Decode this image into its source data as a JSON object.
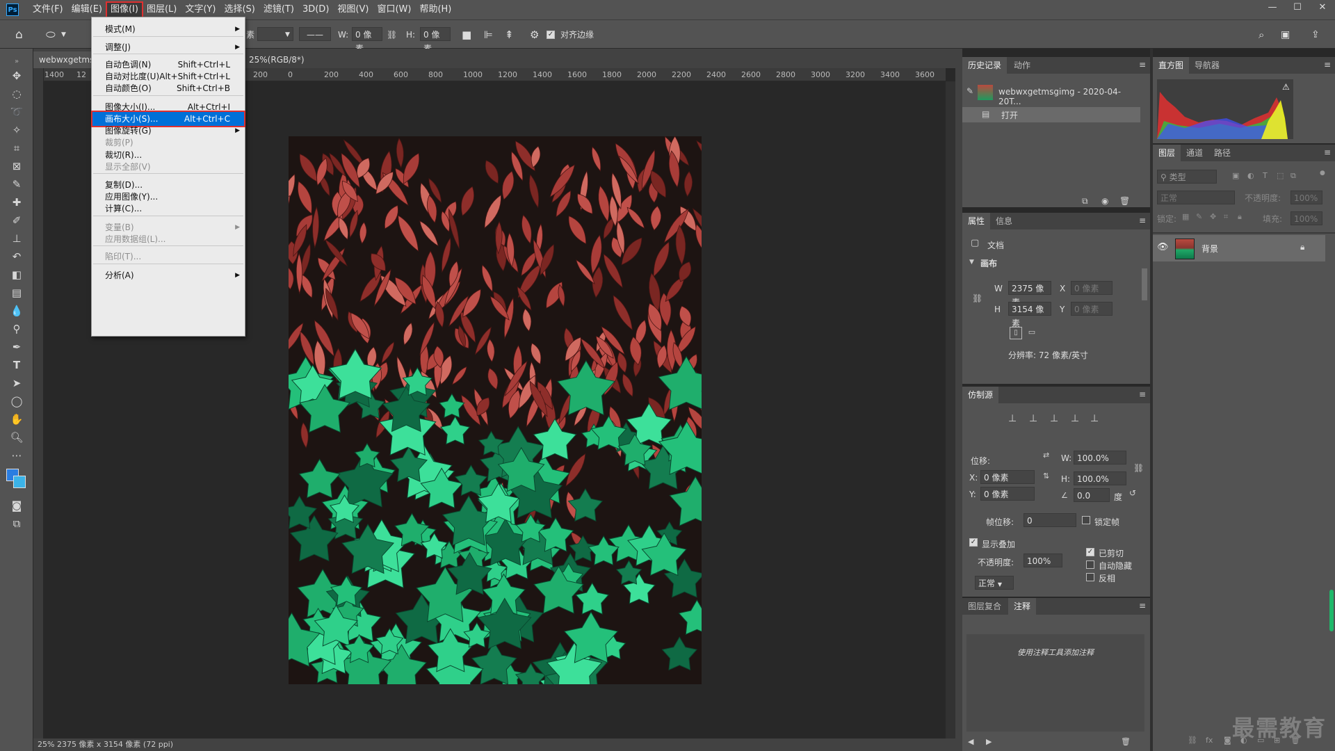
{
  "menubar": {
    "logo": "Ps",
    "items": [
      "文件(F)",
      "编辑(E)",
      "图像(I)",
      "图层(L)",
      "文字(Y)",
      "选择(S)",
      "滤镜(T)",
      "3D(D)",
      "视图(V)",
      "窗口(W)",
      "帮助(H)"
    ],
    "window_controls": [
      "—",
      "☐",
      "✕"
    ]
  },
  "options": {
    "unit_partial": "素",
    "w_label": "W:",
    "w_value": "0 像素",
    "h_label": "H:",
    "h_value": "0 像素",
    "align_edges": "对齐边缘"
  },
  "doc": {
    "tab1": "webwxgetms",
    "tab2": "25%(RGB/8*)",
    "tab2_close": "×",
    "ruler_ticks": [
      "1400",
      "12",
      "200",
      "0",
      "200",
      "400",
      "600",
      "800",
      "1000",
      "1200",
      "1400",
      "1600",
      "1800",
      "2000",
      "2200",
      "2400",
      "2600",
      "2800",
      "3000",
      "3200",
      "3400",
      "3600"
    ],
    "status": "25%   2375 像素 x 3154 像素 (72 ppi)"
  },
  "image_menu": {
    "items": [
      {
        "label": "模式(M)",
        "shortcut": "",
        "sub": true,
        "disabled": false
      },
      {
        "label": "调整(J)",
        "shortcut": "",
        "sub": true,
        "disabled": false
      },
      {
        "label": "自动色调(N)",
        "shortcut": "Shift+Ctrl+L",
        "sub": false,
        "disabled": false
      },
      {
        "label": "自动对比度(U)",
        "shortcut": "Alt+Shift+Ctrl+L",
        "sub": false,
        "disabled": false
      },
      {
        "label": "自动颜色(O)",
        "shortcut": "Shift+Ctrl+B",
        "sub": false,
        "disabled": false
      },
      {
        "label": "图像大小(I)...",
        "shortcut": "Alt+Ctrl+I",
        "sub": false,
        "disabled": false
      },
      {
        "label": "画布大小(S)...",
        "shortcut": "Alt+Ctrl+C",
        "sub": false,
        "disabled": false,
        "selected": true
      },
      {
        "label": "图像旋转(G)",
        "shortcut": "",
        "sub": true,
        "disabled": false
      },
      {
        "label": "裁剪(P)",
        "shortcut": "",
        "sub": false,
        "disabled": true
      },
      {
        "label": "裁切(R)...",
        "shortcut": "",
        "sub": false,
        "disabled": false
      },
      {
        "label": "显示全部(V)",
        "shortcut": "",
        "sub": false,
        "disabled": true
      },
      {
        "label": "复制(D)...",
        "shortcut": "",
        "sub": false,
        "disabled": false
      },
      {
        "label": "应用图像(Y)...",
        "shortcut": "",
        "sub": false,
        "disabled": false
      },
      {
        "label": "计算(C)...",
        "shortcut": "",
        "sub": false,
        "disabled": false
      },
      {
        "label": "变量(B)",
        "shortcut": "",
        "sub": true,
        "disabled": true
      },
      {
        "label": "应用数据组(L)...",
        "shortcut": "",
        "sub": false,
        "disabled": true
      },
      {
        "label": "陷印(T)...",
        "shortcut": "",
        "sub": false,
        "disabled": true
      },
      {
        "label": "分析(A)",
        "shortcut": "",
        "sub": true,
        "disabled": false
      }
    ]
  },
  "history": {
    "tab1": "历史记录",
    "tab2": "动作",
    "snapshot": "webwxgetmsgimg - 2020-04-20T...",
    "step": "打开"
  },
  "histogram": {
    "tab1": "直方图",
    "tab2": "导航器",
    "warn": "⚠"
  },
  "layers": {
    "tab1": "图层",
    "tab2": "通道",
    "tab3": "路径",
    "filter_placeholder": "类型",
    "blend": "正常",
    "opacity_label": "不透明度:",
    "opacity": "100%",
    "lock_label": "锁定:",
    "fill_label": "填充:",
    "fill": "100%",
    "layer_name": "背景"
  },
  "properties": {
    "tab1": "属性",
    "tab2": "信息",
    "doc_label": "文档",
    "canvas_label": "画布",
    "w_label": "W",
    "w": "2375 像素",
    "h_label": "H",
    "h": "3154 像素",
    "x_label": "X",
    "x": "0 像素",
    "y_label": "Y",
    "y": "0 像素",
    "resolution": "分辨率: 72 像素/英寸"
  },
  "clone": {
    "tab": "仿制源",
    "offset_label": "位移:",
    "w_label": "W:",
    "w": "100.0%",
    "h_label": "H:",
    "h": "100.0%",
    "x_label": "X:",
    "x": "0 像素",
    "y_label": "Y:",
    "y": "0 像素",
    "angle": "0.0",
    "deg": "度",
    "frame_offset_label": "帧位移:",
    "frame_offset": "0",
    "lock_frame": "锁定帧",
    "show_overlay": "显示叠加",
    "opacity_label": "不透明度:",
    "opacity": "100%",
    "blend": "正常",
    "clipped": "已剪切",
    "auto_hide": "自动隐藏",
    "invert": "反相"
  },
  "notes": {
    "tab1": "图层复合",
    "tab2": "注释",
    "hint": "使用注释工具添加注释"
  },
  "watermark": "最需教育"
}
